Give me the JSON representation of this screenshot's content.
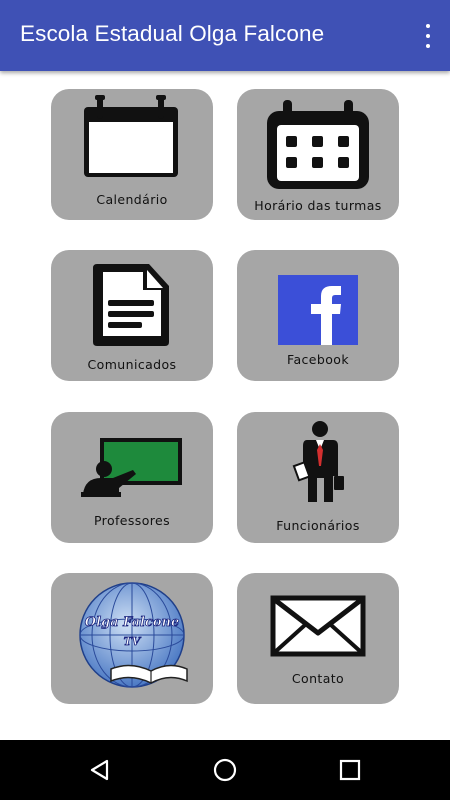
{
  "appbar": {
    "title": "Escola Estadual Olga Falcone",
    "menu_icon": "more-vert-icon"
  },
  "tiles": [
    {
      "label": "Calendário",
      "icon": "calendar-icon"
    },
    {
      "label": "Horário das turmas",
      "icon": "schedule-calendar-icon"
    },
    {
      "label": "Comunicados",
      "icon": "document-icon"
    },
    {
      "label": "Facebook",
      "icon": "facebook-icon"
    },
    {
      "label": "Professores",
      "icon": "teacher-board-icon"
    },
    {
      "label": "Funcionários",
      "icon": "employee-icon"
    },
    {
      "label": "",
      "icon": "globe-book-logo",
      "logo_text_line1": "Olga Falcone",
      "logo_text_line2": "TV"
    },
    {
      "label": "Contato",
      "icon": "envelope-icon"
    }
  ],
  "navbar": {
    "back_icon": "back-triangle-icon",
    "home_icon": "home-circle-icon",
    "recents_icon": "recents-square-icon"
  },
  "colors": {
    "appbar": "#3f51b5",
    "tile": "#a6a6a6",
    "facebook": "#3b4fd8",
    "board": "#1e8a3c",
    "tie": "#d32f2f"
  }
}
